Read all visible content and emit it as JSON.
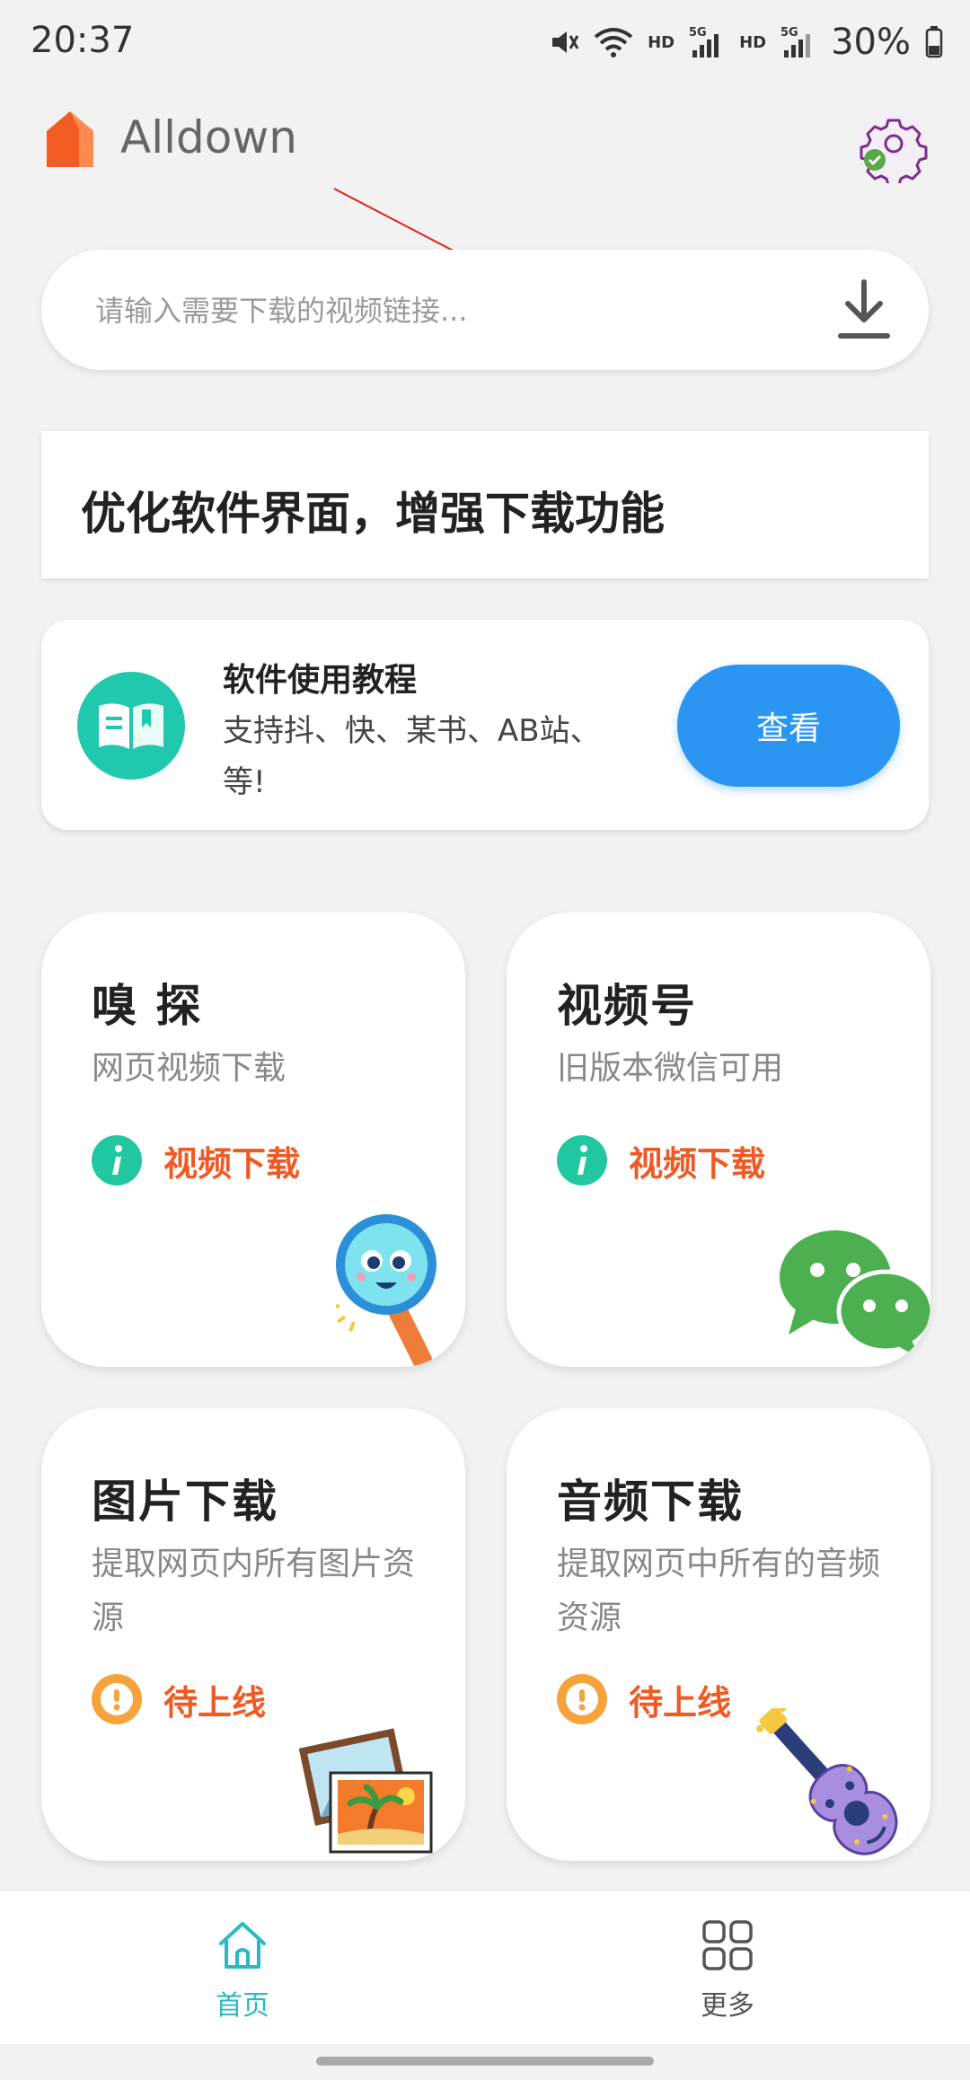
{
  "status_bar": {
    "time": "20:37",
    "hd1": "HD",
    "hd2": "HD",
    "network1": "5G",
    "network2": "5G",
    "battery": "30%",
    "icons": [
      "mute-icon",
      "wifi-icon",
      "signal-icon",
      "battery-icon"
    ]
  },
  "header": {
    "app_name": "Alldown",
    "brand_color": "#f35b24"
  },
  "search": {
    "placeholder": "请输入需要下载的视频链接...",
    "value": ""
  },
  "notice": {
    "text": "优化软件界面，增强下载功能"
  },
  "tutorial": {
    "title": "软件使用教程",
    "description": "支持抖、快、某书、AB站、等!",
    "button_label": "查看",
    "button_color": "#2a96f1"
  },
  "features": [
    {
      "title": "嗅 探",
      "subtitle": "网页视频下载",
      "status": "视频下载",
      "status_icon": "info-icon",
      "art": "magnifier-mascot-icon"
    },
    {
      "title": "视频号",
      "subtitle": "旧版本微信可用",
      "status": "视频下载",
      "status_icon": "info-icon",
      "art": "wechat-icon"
    },
    {
      "title": "图片下载",
      "subtitle": "提取网页内所有图片资源",
      "status": "待上线",
      "status_icon": "warning-icon",
      "art": "pictures-icon"
    },
    {
      "title": "音频下载",
      "subtitle": "提取网页中所有的音频资源",
      "status": "待上线",
      "status_icon": "warning-icon",
      "art": "guitar-icon"
    }
  ],
  "colors": {
    "status_text": "#ef5a24",
    "info_green": "#21c7a0",
    "warning_orange": "#f5a33a",
    "nav_active": "#2bb8c4"
  },
  "bottom_nav": {
    "items": [
      {
        "label": "首页",
        "icon": "home-icon",
        "active": true
      },
      {
        "label": "更多",
        "icon": "grid-icon",
        "active": false
      }
    ]
  }
}
